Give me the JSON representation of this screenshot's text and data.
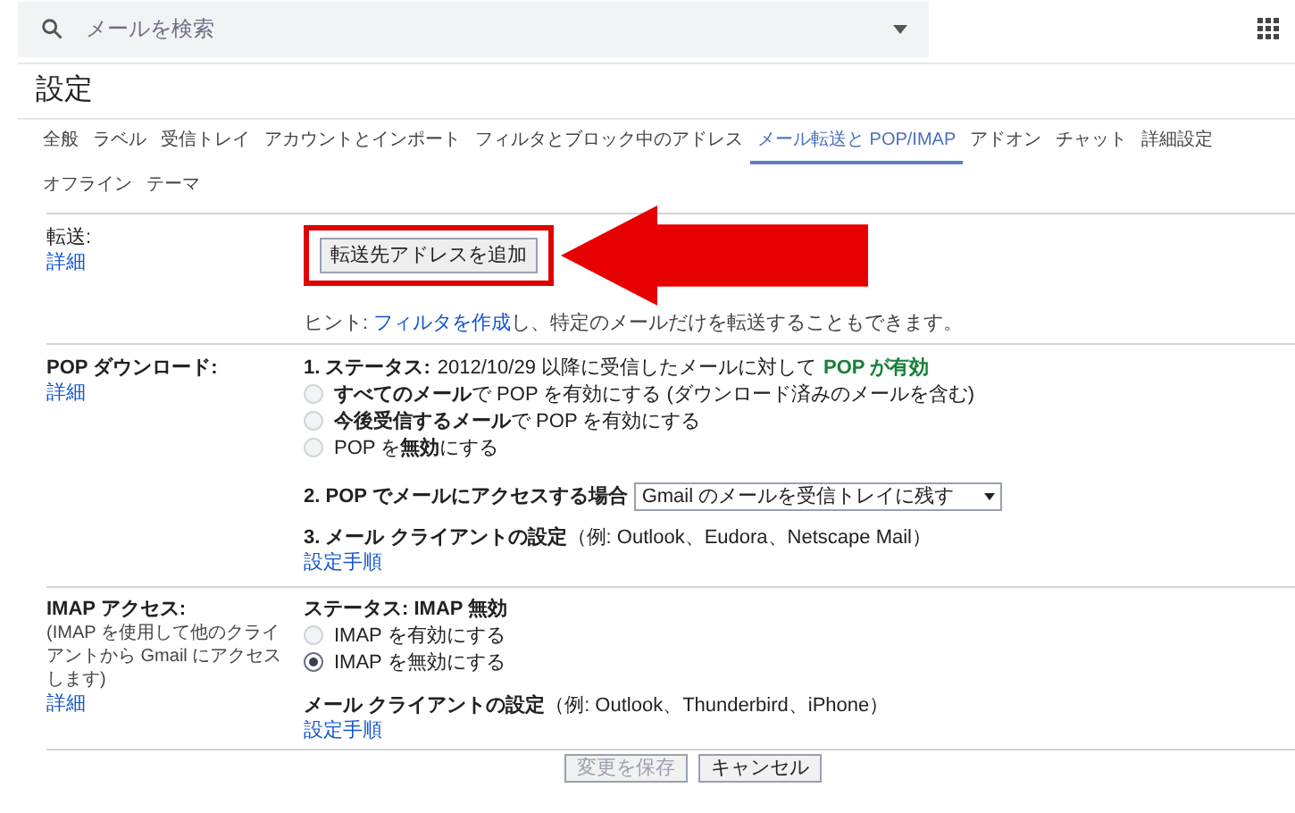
{
  "search": {
    "placeholder": "メールを検索"
  },
  "title": "設定",
  "tabs": [
    {
      "label": "全般",
      "selected": false
    },
    {
      "label": "ラベル",
      "selected": false
    },
    {
      "label": "受信トレイ",
      "selected": false
    },
    {
      "label": "アカウントとインポート",
      "selected": false
    },
    {
      "label": "フィルタとブロック中のアドレス",
      "selected": false
    },
    {
      "label": "メール転送と POP/IMAP",
      "selected": true
    },
    {
      "label": "アドオン",
      "selected": false
    },
    {
      "label": "チャット",
      "selected": false
    },
    {
      "label": "詳細設定",
      "selected": false
    },
    {
      "label": "オフライン",
      "selected": false
    },
    {
      "label": "テーマ",
      "selected": false
    }
  ],
  "forwarding": {
    "label": "転送:",
    "link": "詳細",
    "button": "転送先アドレスを追加",
    "hint_before": "ヒント: ",
    "hint_link": "フィルタを作成",
    "hint_after": "し、特定のメールだけを転送することもできます。"
  },
  "pop": {
    "label": "POP ダウンロード:",
    "link": "詳細",
    "status_label": "1. ステータス:",
    "status_text": "2012/10/29 以降に受信したメールに対して",
    "status_value": "POP が有効",
    "options": [
      {
        "label": "**すべてのメール**で POP を有効にする (ダウンロード済みのメールを含む)",
        "selected": false
      },
      {
        "label": "**今後受信するメール**で POP を有効にする",
        "selected": false
      },
      {
        "label": "POP を**無効**にする",
        "selected": false
      }
    ],
    "access_label": "2. POP でメールにアクセスする場合",
    "access_value": "Gmail のメールを受信トレイに残す",
    "client_label": "3. メール クライアントの設定",
    "client_note": "（例: Outlook、Eudora、Netscape Mail）",
    "client_link": "設定手順"
  },
  "imap": {
    "label": "IMAP アクセス:",
    "note": "(IMAP を使用して他のクライアントから Gmail にアクセスします)",
    "link": "詳細",
    "status": "ステータス: IMAP 無効",
    "options": [
      {
        "label": "IMAP を有効にする",
        "selected": false
      },
      {
        "label": "IMAP を無効にする",
        "selected": true
      }
    ],
    "client_label": "メール クライアントの設定",
    "client_note": "（例: Outlook、Thunderbird、iPhone）",
    "client_link": "設定手順"
  },
  "buttons": [
    "変更を保存",
    "キャンセル"
  ]
}
